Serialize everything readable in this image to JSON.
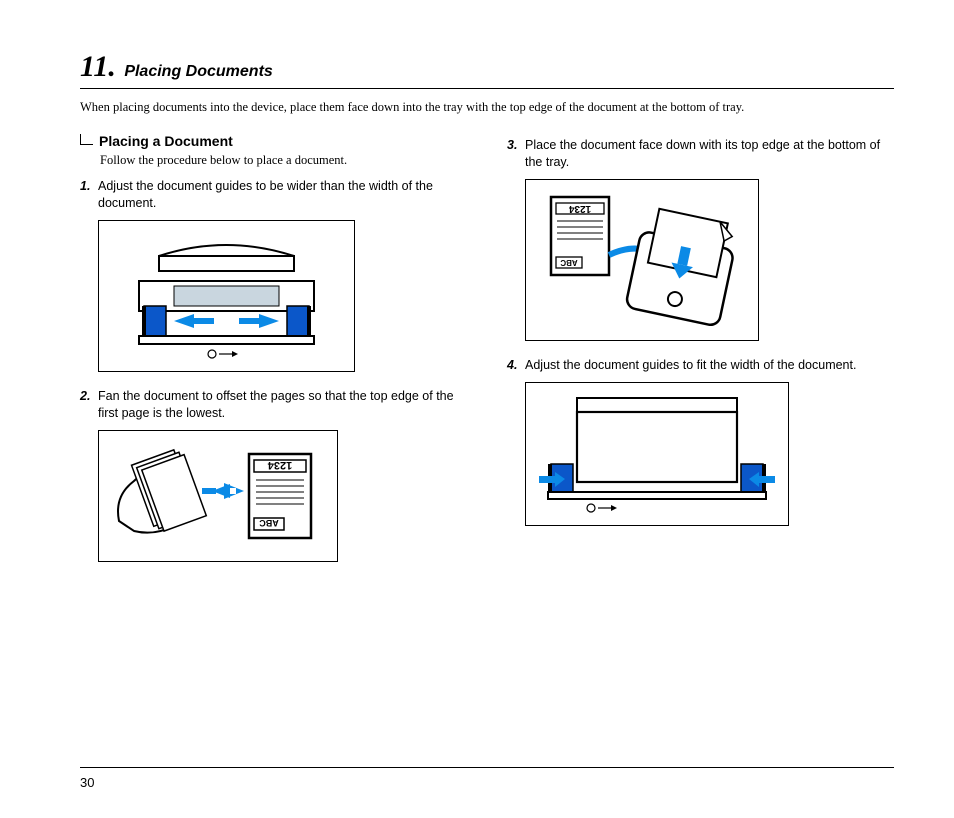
{
  "chapter": {
    "number": "11.",
    "title": "Placing Documents"
  },
  "intro": "When placing documents into the device, place them face down into the tray with the top edge of the document at the bottom of tray.",
  "section": {
    "heading": "Placing a Document",
    "sub": "Follow the procedure below to place a document."
  },
  "steps": {
    "s1": {
      "num": "1.",
      "text": "Adjust the document guides to be wider than the width of the document."
    },
    "s2": {
      "num": "2.",
      "text": "Fan the document to offset the pages so that the top edge of the first page is the lowest."
    },
    "s3": {
      "num": "3.",
      "text": "Place the document face down with its top edge at the bottom of the tray."
    },
    "s4": {
      "num": "4.",
      "text": "Adjust the document guides to fit the width of the document."
    }
  },
  "figures": {
    "f1_alt": "Scanner feeder with guides being widened outward",
    "f2_alt": "Fanning a stack of pages labeled ABC 1234",
    "f3_alt": "Inserting document face down top edge first into tray",
    "f4_alt": "Adjusting guides inward to fit document width",
    "doc_label_top": "1234",
    "doc_label_bottom": "ABC"
  },
  "page_number": "30"
}
